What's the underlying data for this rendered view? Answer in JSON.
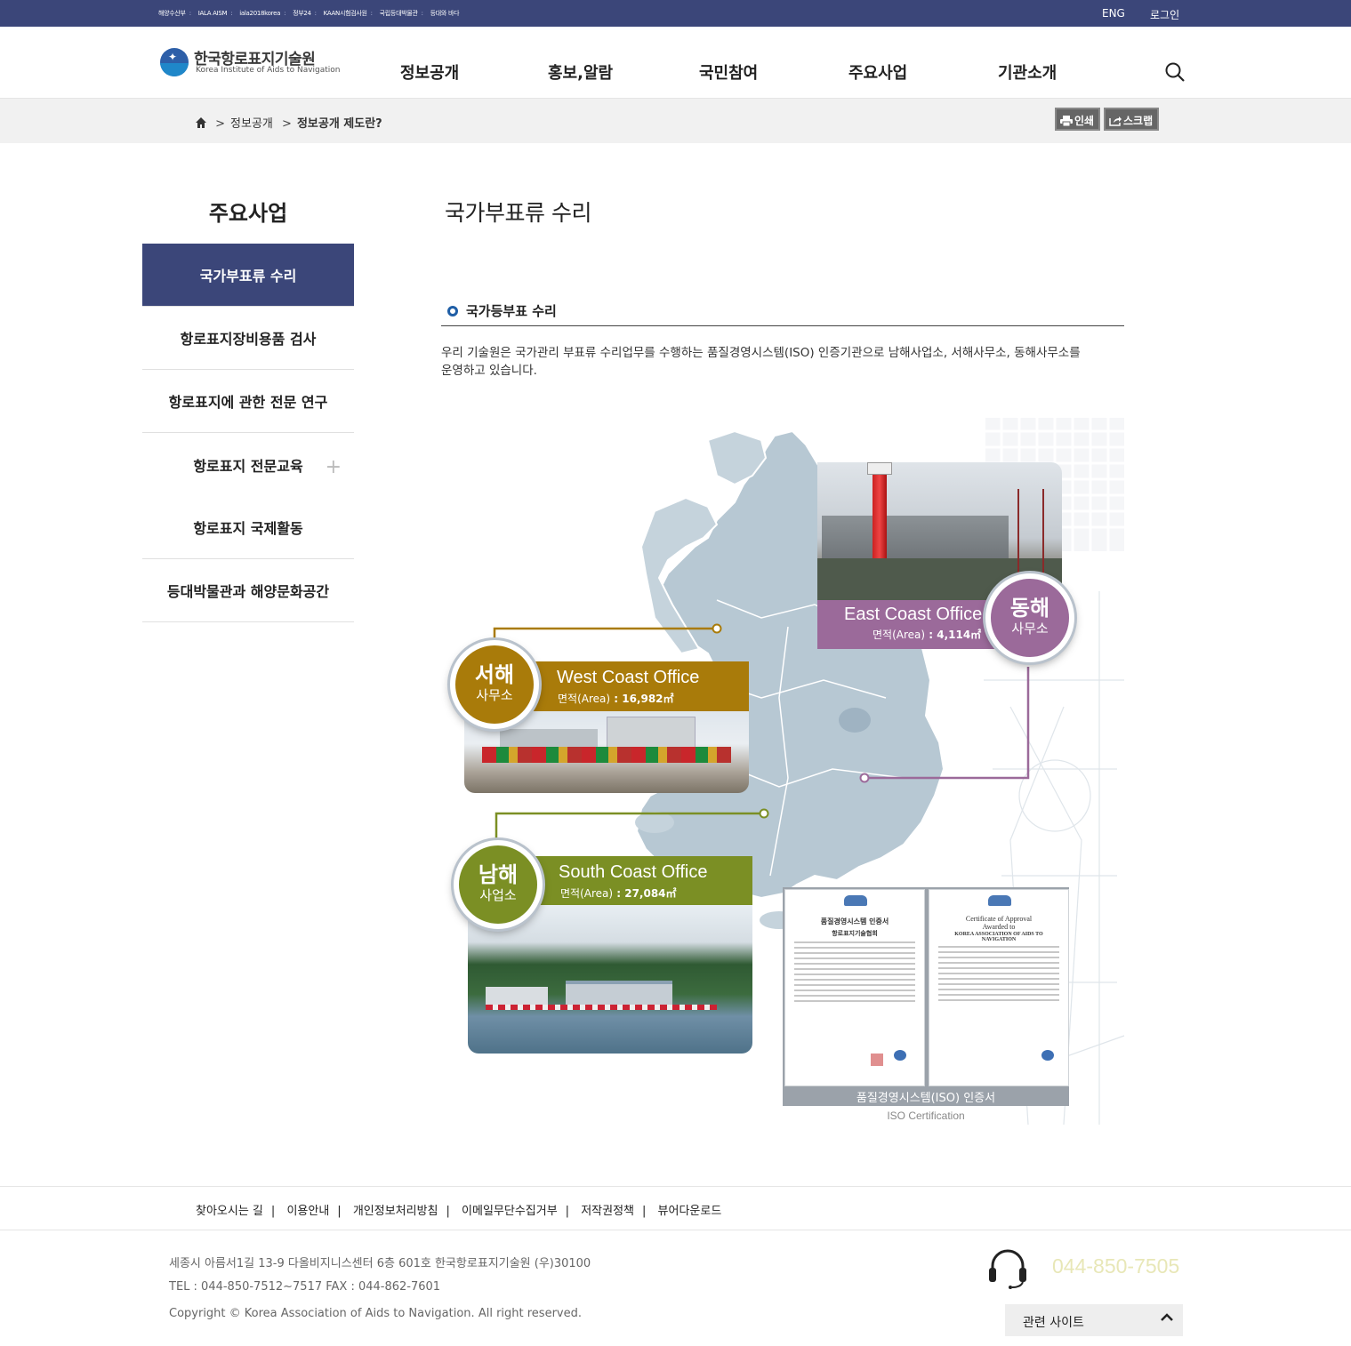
{
  "topbar": {
    "links": [
      "해양수산부",
      "IALA AISM",
      "iala2018korea",
      "정부24",
      "KAAN시험검사원",
      "국립등대박물관",
      "등대와 바다"
    ],
    "eng": "ENG",
    "login": "로그인"
  },
  "header": {
    "logo_kr": "한국항로표지기술원",
    "logo_en": "Korea Institute of Aids to Navigation",
    "nav": [
      "정보공개",
      "홍보,알람",
      "국민참여",
      "주요사업",
      "기관소개"
    ]
  },
  "breadcrumb": {
    "items": [
      "정보공개",
      "정보공개 제도란?"
    ],
    "print": "인쇄",
    "scrap": "스크랩"
  },
  "sidebar": {
    "title": "주요사업",
    "items": [
      {
        "label": "국가부표류 수리",
        "active": true
      },
      {
        "label": "항로표지장비용품 검사"
      },
      {
        "label": "항로표지에 관한 전문 연구"
      },
      {
        "label": "항로표지 전문교육",
        "expand": "+"
      },
      {
        "label": "항로표지 국제활동"
      },
      {
        "label": "등대박물관과 해양문화공간"
      }
    ]
  },
  "main": {
    "title": "국가부표류 수리",
    "section": "국가등부표 수리",
    "description": "우리 기술원은 국가관리 부표류 수리업무를 수행하는 품질경영시스템(ISO) 인증기관으로 남해사업소, 서해사무소, 동해사무소를 운영하고 있습니다."
  },
  "offices": {
    "east": {
      "kr1": "동해",
      "kr2": "사무소",
      "en": "East Coast Office",
      "area_label": "면적(Area)",
      "area": "4,114㎡",
      "color": "#9b6a9a"
    },
    "west": {
      "kr1": "서해",
      "kr2": "사무소",
      "en": "West Coast Office",
      "area_label": "면적(Area)",
      "area": "16,982㎡",
      "color": "#a97b0a"
    },
    "south": {
      "kr1": "남해",
      "kr2": "사업소",
      "en": "South Coast Office",
      "area_label": "면적(Area)",
      "area": "27,084㎡",
      "color": "#7b8f24"
    }
  },
  "certificate": {
    "kr_title": "품질경영시스템 인증서",
    "kr_org": "항로표지기술협회",
    "en_title": "Certificate of Approval",
    "en_awarded": "Awarded to",
    "en_org": "KOREA ASSOCIATION OF AIDS TO NAVIGATION",
    "caption": "품질경영시스템(ISO) 인증서",
    "label_en": "ISO Certification"
  },
  "footer": {
    "links": [
      "찾아오시는 길",
      "이용안내",
      "개인정보처리방침",
      "이메일무단수집거부",
      "저작권정책",
      "뷰어다운로드"
    ],
    "address": "세종시 아름서1길 13-9 다올비지니스센터 6층 601호 한국항로표지기술원 (우)30100",
    "tel": "TEL : 044-850-7512~7517 FAX : 044-862-7601",
    "copyright": "Copyright © Korea Association of Aids to Navigation. All right reserved.",
    "phone": "044-850-7505",
    "related": "관련 사이트"
  },
  "colors": {
    "navy": "#3b4679",
    "accent_blue": "#1f5ea6",
    "map": "#b7c8d3"
  }
}
